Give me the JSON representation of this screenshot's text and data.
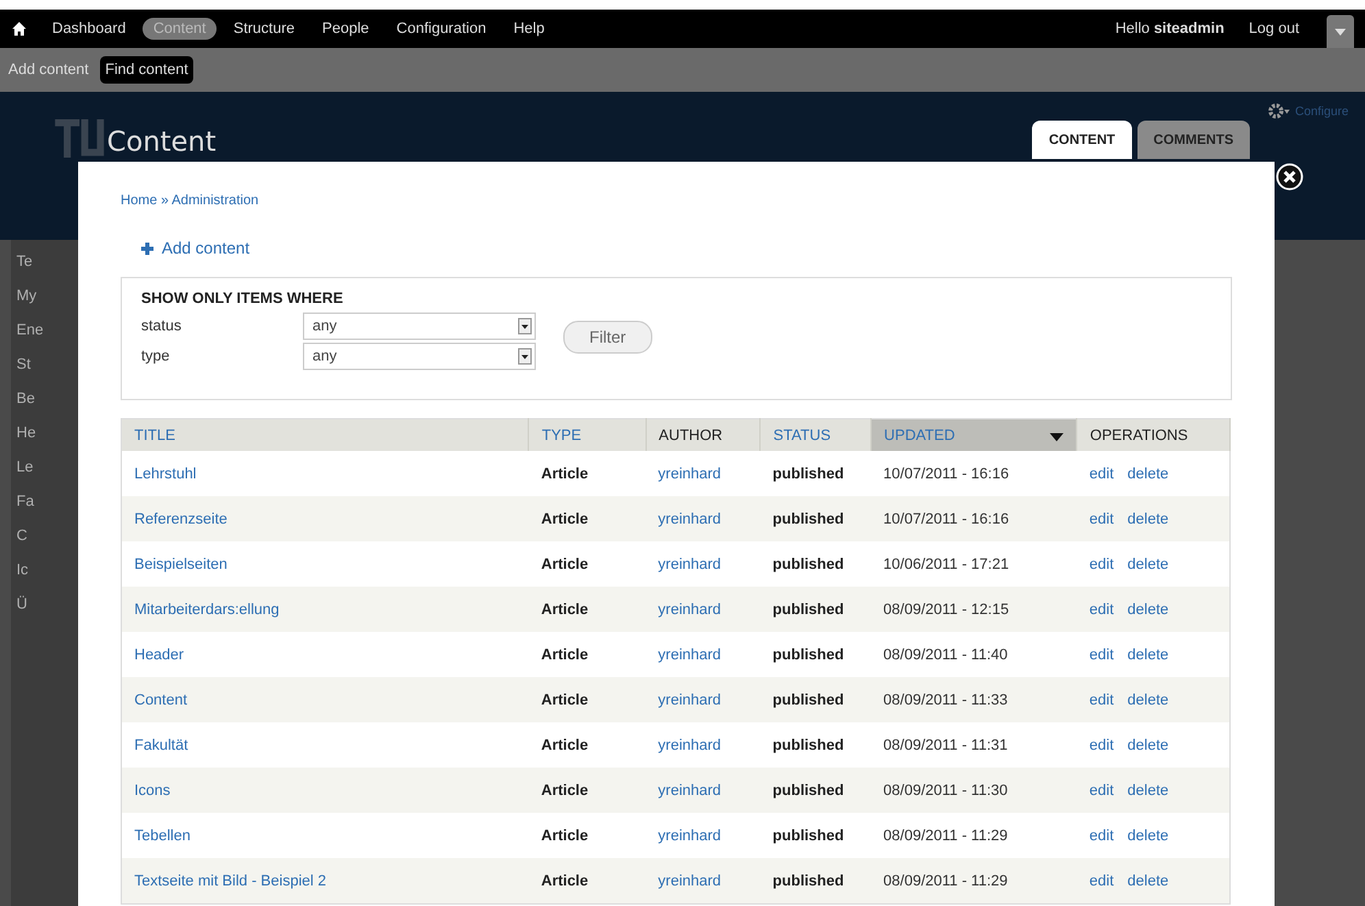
{
  "toolbar": {
    "menu": [
      {
        "label": "Dashboard",
        "selected": false
      },
      {
        "label": "Content",
        "selected": true
      },
      {
        "label": "Structure",
        "selected": false
      },
      {
        "label": "People",
        "selected": false
      },
      {
        "label": "Configuration",
        "selected": false
      },
      {
        "label": "Help",
        "selected": false
      }
    ],
    "greeting": "Hello **siteadmin**",
    "logout": "Log out"
  },
  "shortcuts": [
    {
      "label": "Add content",
      "selected": false
    },
    {
      "label": "Find content",
      "selected": true
    }
  ],
  "header": {
    "title": "Content",
    "configure": "Configure",
    "tabs": [
      {
        "label": "CONTENT",
        "selected": true
      },
      {
        "label": "COMMENTS",
        "selected": false
      }
    ]
  },
  "background_fragments": [
    "Te",
    "My",
    "Ene",
    "St",
    "Be",
    "He",
    "Le",
    "Fa",
    "C",
    "Ic",
    "Ü"
  ],
  "modal": {
    "breadcrumb": "Home » Administration",
    "add_link": "Add content",
    "filter": {
      "legend": "SHOW ONLY ITEMS WHERE",
      "fields": [
        {
          "label": "status",
          "value": "any"
        },
        {
          "label": "type",
          "value": "any"
        }
      ],
      "button": "Filter"
    },
    "table": {
      "columns": [
        {
          "label": "TITLE",
          "sortable": true,
          "sorted": false
        },
        {
          "label": "TYPE",
          "sortable": true,
          "sorted": false
        },
        {
          "label": "AUTHOR",
          "sortable": false,
          "sorted": false
        },
        {
          "label": "STATUS",
          "sortable": true,
          "sorted": false
        },
        {
          "label": "UPDATED",
          "sortable": true,
          "sorted": true
        },
        {
          "label": "OPERATIONS",
          "sortable": false,
          "sorted": false
        }
      ],
      "rows": [
        {
          "title": "Lehrstuhl",
          "type": "Article",
          "author": "yreinhard",
          "status": "published",
          "updated": "10/07/2011 - 16:16",
          "edit": "edit",
          "delete": "delete"
        },
        {
          "title": "Referenzseite",
          "type": "Article",
          "author": "yreinhard",
          "status": "published",
          "updated": "10/07/2011 - 16:16",
          "edit": "edit",
          "delete": "delete"
        },
        {
          "title": "Beispielseiten",
          "type": "Article",
          "author": "yreinhard",
          "status": "published",
          "updated": "10/06/2011 - 17:21",
          "edit": "edit",
          "delete": "delete"
        },
        {
          "title": "Mitarbeiterdars:ellung",
          "type": "Article",
          "author": "yreinhard",
          "status": "published",
          "updated": "08/09/2011 - 12:15",
          "edit": "edit",
          "delete": "delete"
        },
        {
          "title": "Header",
          "type": "Article",
          "author": "yreinhard",
          "status": "published",
          "updated": "08/09/2011 - 11:40",
          "edit": "edit",
          "delete": "delete"
        },
        {
          "title": "Content",
          "type": "Article",
          "author": "yreinhard",
          "status": "published",
          "updated": "08/09/2011 - 11:33",
          "edit": "edit",
          "delete": "delete"
        },
        {
          "title": "Fakultät",
          "type": "Article",
          "author": "yreinhard",
          "status": "published",
          "updated": "08/09/2011 - 11:31",
          "edit": "edit",
          "delete": "delete"
        },
        {
          "title": "Icons",
          "type": "Article",
          "author": "yreinhard",
          "status": "published",
          "updated": "08/09/2011 - 11:30",
          "edit": "edit",
          "delete": "delete"
        },
        {
          "title": "Tebellen",
          "type": "Article",
          "author": "yreinhard",
          "status": "published",
          "updated": "08/09/2011 - 11:29",
          "edit": "edit",
          "delete": "delete"
        },
        {
          "title": "Textseite mit Bild - Beispiel 2",
          "type": "Article",
          "author": "yreinhard",
          "status": "published",
          "updated": "08/09/2011 - 11:29",
          "edit": "edit",
          "delete": "delete"
        }
      ]
    }
  }
}
